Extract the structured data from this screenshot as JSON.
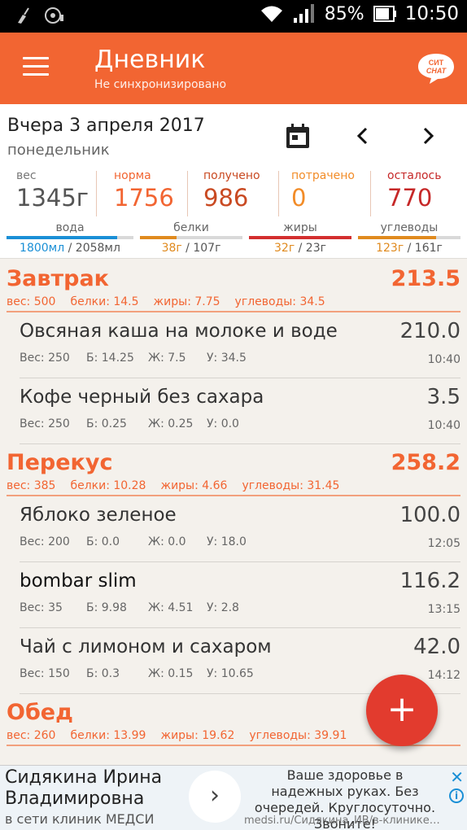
{
  "status_bar": {
    "battery": "85%",
    "time": "10:50",
    "icons": [
      "broom-icon",
      "media-icon",
      "wifi-icon",
      "signal-icon",
      "battery-icon"
    ]
  },
  "app_bar": {
    "title": "Дневник",
    "subtitle": "Не синхронизировано",
    "chat_logo_line1": "СИТ",
    "chat_logo_line2": "CHAT",
    "accent_color": "#f26532"
  },
  "date": {
    "label": "Вчера 3 апреля 2017",
    "weekday": "понедельник"
  },
  "stats": {
    "weight": {
      "label": "вес",
      "value": "1345г"
    },
    "norm": {
      "label": "норма",
      "value": "1756"
    },
    "received": {
      "label": "получено",
      "value": "986"
    },
    "spent": {
      "label": "потрачено",
      "value": "0"
    },
    "left": {
      "label": "осталось",
      "value": "770"
    }
  },
  "macros": {
    "water": {
      "label": "вода",
      "current": "1800мл",
      "total": " / 2058мл",
      "fill": 0.87,
      "color": "#1a8fd6"
    },
    "protein": {
      "label": "белки",
      "current": "38г",
      "total": " / 107г",
      "fill": 0.36,
      "color": "#e08a1e"
    },
    "fat": {
      "label": "жиры",
      "current": "32г",
      "total": " / 23г",
      "fill": 1.0,
      "color": "#d32f2f"
    },
    "carbs": {
      "label": "углеводы",
      "current": "123г",
      "total": " / 161г",
      "fill": 0.76,
      "color": "#e08a1e"
    }
  },
  "meals": [
    {
      "name": "Завтрак",
      "total": "213.5",
      "weight": "вес: 500",
      "protein": "белки: 14.5",
      "fat": "жиры: 7.75",
      "carbs": "углеводы: 34.5",
      "items": [
        {
          "name": "Овсяная каша на молоке и воде",
          "kcal": "210.0",
          "w": "Вес: 250",
          "p": "Б: 14.25",
          "f": "Ж: 7.5",
          "c": "У: 34.5",
          "time": "10:40"
        },
        {
          "name": "Кофе черный без сахара",
          "kcal": "3.5",
          "w": "Вес: 250",
          "p": "Б: 0.25",
          "f": "Ж: 0.25",
          "c": "У: 0.0",
          "time": "10:40"
        }
      ]
    },
    {
      "name": "Перекус",
      "total": "258.2",
      "weight": "вес: 385",
      "protein": "белки: 10.28",
      "fat": "жиры: 4.66",
      "carbs": "углеводы: 31.45",
      "items": [
        {
          "name": "Яблоко зеленое",
          "kcal": "100.0",
          "w": "Вес: 200",
          "p": "Б: 0.0",
          "f": "Ж: 0.0",
          "c": "У: 18.0",
          "time": "12:05"
        },
        {
          "name": "bombar slim",
          "kcal": "116.2",
          "w": "Вес: 35",
          "p": "Б: 9.98",
          "f": "Ж: 4.51",
          "c": "У: 2.8",
          "time": "13:15"
        },
        {
          "name": "Чай с лимоном и сахаром",
          "kcal": "42.0",
          "w": "Вес: 150",
          "p": "Б: 0.3",
          "f": "Ж: 0.15",
          "c": "У: 10.65",
          "time": "14:12"
        }
      ]
    },
    {
      "name": "Обед",
      "total": "",
      "weight": "вес: 260",
      "protein": "белки: 13.99",
      "fat": "жиры: 19.62",
      "carbs": "углеводы: 39.91",
      "items": []
    }
  ],
  "fab": {
    "label": "+"
  },
  "ad": {
    "name": "Сидякина Ирина Владимировна",
    "sub": "в сети клиник МЕДСИ",
    "text": "Ваше здоровье в надежных руках. Без очередей. Круглосуточно. Звоните!",
    "url": "medsi.ru/Сидякина_ИВ/в-клинике…",
    "arrow": "›",
    "close": "✕",
    "info": "i"
  }
}
